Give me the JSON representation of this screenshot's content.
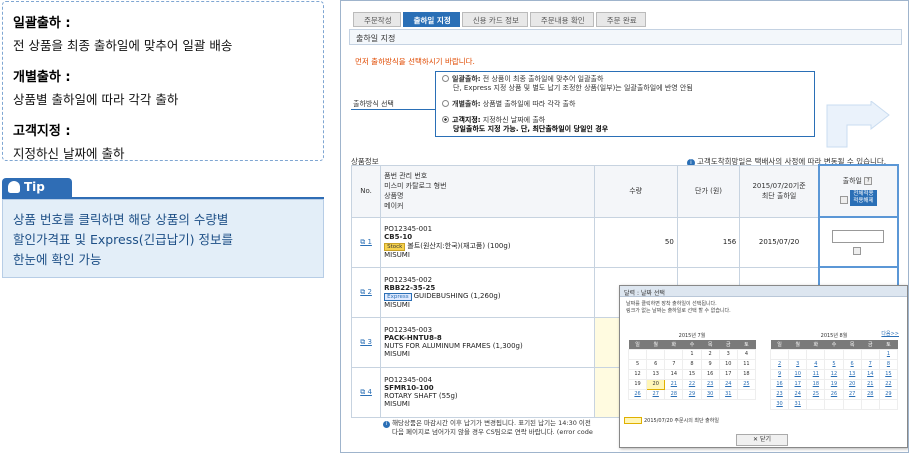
{
  "explain": {
    "items": [
      {
        "term": "일괄출하 :",
        "desc": "전 상품을 최종 출하일에 맞추어 일괄 배송"
      },
      {
        "term": "개별출하 :",
        "desc": "상품별 출하일에 따라 각각 출하"
      },
      {
        "term": "고객지정 :",
        "desc": "지정하신 날짜에 출하"
      }
    ]
  },
  "tip": {
    "label": "Tip",
    "lines": [
      "상품 번호를 클릭하면 해당 상품의 수량별",
      "할인가격표 및 Express(긴급납기) 정보를",
      "한눈에 확인 가능"
    ]
  },
  "shot": {
    "steps": [
      "주문작성",
      "출하일 지정",
      "신용 카드 정보",
      "주문내용 확인",
      "주문 완료"
    ],
    "section_title": "출하일 지정",
    "warning": "먼저 출하방식을 선택하시기 바랍니다.",
    "ship_label": "출하방식 선택",
    "options": [
      {
        "bold": "일괄출하:",
        "text": " 전 상품이 최종 출하일에 맞추어 일괄출하",
        "sub": "단, Express 지정 상품 및 별도 납기 조정한 상품(일부)는 일괄출하일에 반영 안됨"
      },
      {
        "bold": "개별출하:",
        "text": " 상품별 출하일에 따라 각각 출하",
        "sub": ""
      },
      {
        "bold": "고객지정:",
        "text": " 지정하신 날짜에 출하",
        "sub": "당일출하도 지정 가능. 단, 최단출하일이 당일인 경우"
      }
    ],
    "product_header": "상품정보",
    "product_note": "고객도착희망일은 택배사의 사정에 따라 변동될 수 있습니다.",
    "table": {
      "h_no": "No.",
      "h_info": [
        "품번 관리 번호",
        "미스미 카탈로그 형번",
        "상품명",
        "메이커"
      ],
      "h_qty": "수량",
      "h_price": "단가 (원)",
      "h_date": [
        "2015/07/20기준",
        "최단 출하일"
      ],
      "h_ship": "출하일",
      "h_ship_help": "?",
      "apply_btn": [
        "전체적용",
        "적용해제"
      ],
      "rows": [
        {
          "no": "1",
          "code": "PO12345-001",
          "part": "CB5-10",
          "badge": "Stock",
          "name": "볼트(원산지:한국)(재고품) (100g)",
          "maker": "MISUMI",
          "qty": "50",
          "price": "156",
          "date": "2015/07/20"
        },
        {
          "no": "2",
          "code": "PO12345-002",
          "part": "RBB22-35-25",
          "badge": "Express",
          "name": "GUIDEBUSHING (1,260g)",
          "maker": "MISUMI",
          "qty": "",
          "price": "",
          "date": ""
        },
        {
          "no": "3",
          "code": "PO12345-003",
          "part": "PACK-HNTU8-8",
          "badge": "",
          "name": "NUTS FOR ALUMINUM FRAMES (1,300g)",
          "maker": "MISUMI",
          "qty": "",
          "price": "",
          "date": ""
        },
        {
          "no": "4",
          "code": "PO12345-004",
          "part": "SFMR10-100",
          "badge": "",
          "name": "ROTARY SHAFT (55g)",
          "maker": "MISUMI",
          "qty": "",
          "price": "",
          "date": ""
        }
      ]
    },
    "footnote": [
      "해당상품은 마감시간 이후 납기가 변경됩니다. 표기된 납기는 14:30 이전",
      "다음 페이지로 넘어가지 않을 경우 CS팀으로 연락 바랍니다. (error code"
    ]
  },
  "popup": {
    "title": "달력 : 날짜 선택",
    "text1": "날짜를 클릭하면 장착 출하일이 선택됩니다.",
    "text2": "링크가 없는 날짜는 출하일로 선택 할 수 없습니다.",
    "next": "다음>>",
    "weekdays": [
      "일",
      "월",
      "화",
      "수",
      "목",
      "금",
      "토"
    ],
    "july": {
      "title": "2015년 7월",
      "weeks": [
        [
          "",
          "",
          "",
          "1",
          "2",
          "3",
          "4"
        ],
        [
          "5",
          "6",
          "7",
          "8",
          "9",
          "10",
          "11"
        ],
        [
          "12",
          "13",
          "14",
          "15",
          "16",
          "17",
          "18"
        ],
        [
          "19",
          "20",
          "21",
          "22",
          "23",
          "24",
          "25"
        ],
        [
          "26",
          "27",
          "28",
          "29",
          "30",
          "31",
          ""
        ]
      ]
    },
    "aug": {
      "title": "2015년 8월",
      "weeks": [
        [
          "",
          "",
          "",
          "",
          "",
          "",
          "1"
        ],
        [
          "2",
          "3",
          "4",
          "5",
          "6",
          "7",
          "8"
        ],
        [
          "9",
          "10",
          "11",
          "12",
          "13",
          "14",
          "15"
        ],
        [
          "16",
          "17",
          "18",
          "19",
          "20",
          "21",
          "22"
        ],
        [
          "23",
          "24",
          "25",
          "26",
          "27",
          "28",
          "29"
        ],
        [
          "30",
          "31",
          "",
          "",
          "",
          "",
          ""
        ]
      ]
    },
    "note": "2015/07/20 주문시의 최단 출하일",
    "close": "닫기"
  }
}
